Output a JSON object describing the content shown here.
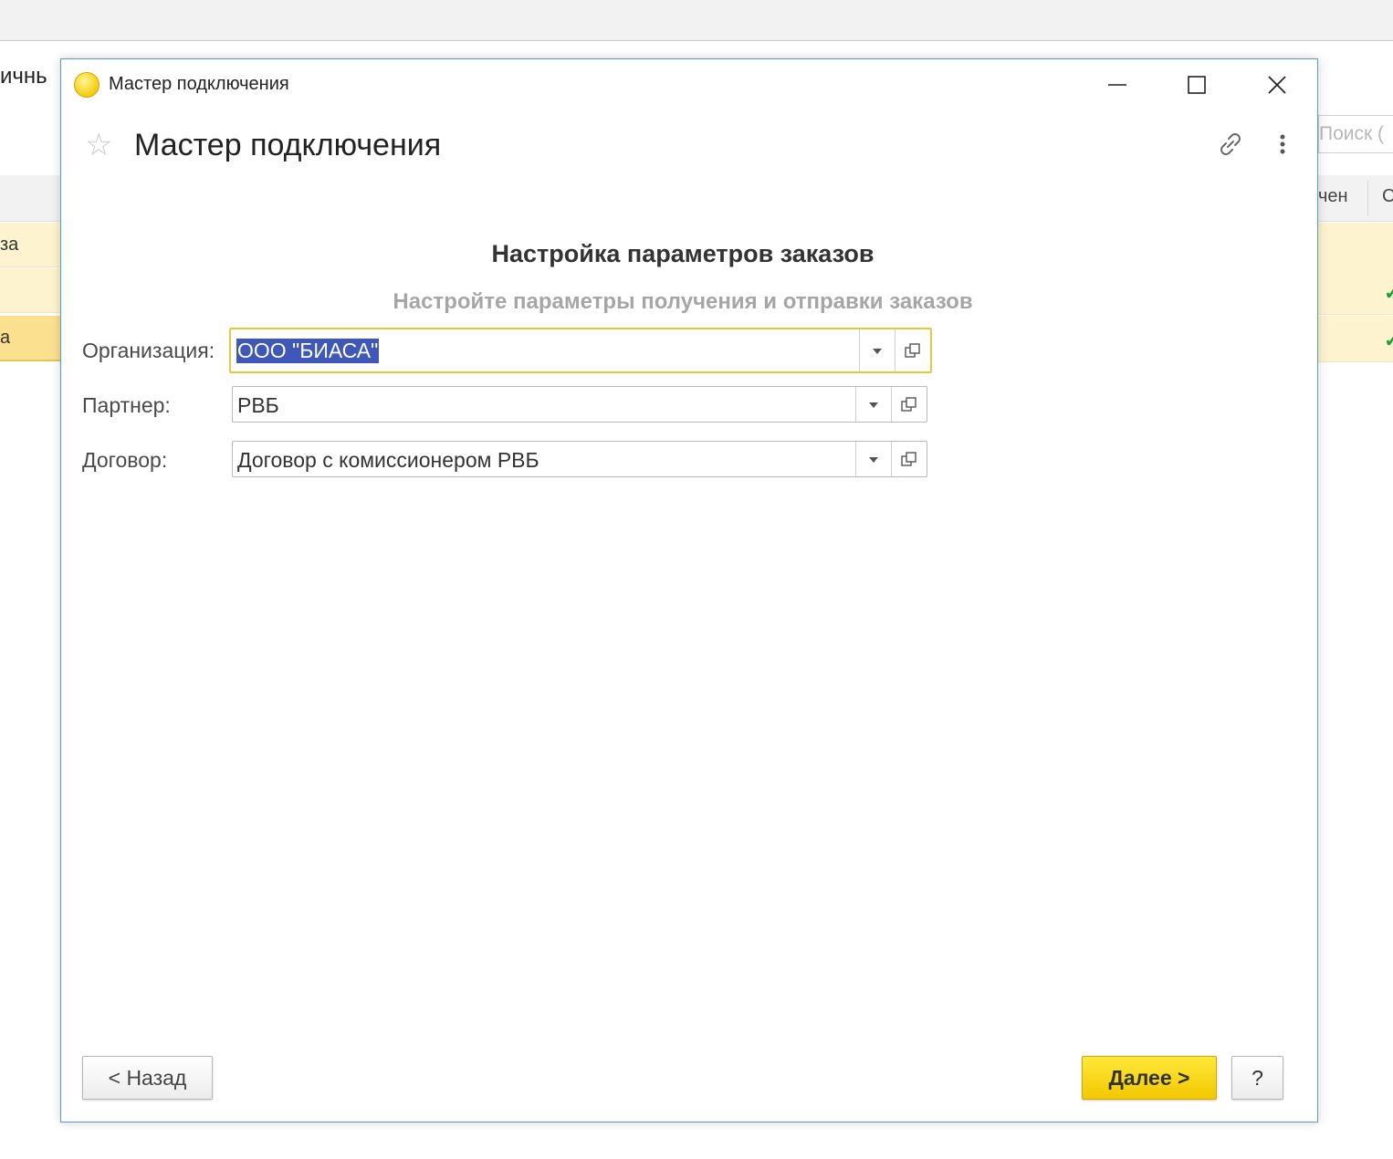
{
  "background": {
    "left_title_fragment": "ичнь",
    "left_rows": [
      "за",
      "",
      "а"
    ],
    "search_placeholder": "Поиск (",
    "right_header": [
      "чен",
      "С"
    ],
    "right_row_ticks": [
      "",
      "✓",
      "✓"
    ]
  },
  "dialog": {
    "window_title": "Мастер подключения",
    "form_title": "Мастер подключения",
    "section_title": "Настройка параметров заказов",
    "section_subtitle": "Настройте параметры получения и отправки заказов",
    "fields": [
      {
        "label": "Организация:",
        "value": "ООО \"БИАСА\""
      },
      {
        "label": "Партнер:",
        "value": "РВБ"
      },
      {
        "label": "Договор:",
        "value": "Договор с комиссионером РВБ"
      }
    ],
    "buttons": {
      "back": "< Назад",
      "next": "Далее >",
      "help": "?"
    }
  },
  "colors": {
    "accent_yellow": "#f2c800",
    "focus_border": "#f3c53a",
    "selection": "#3e57b8",
    "dialog_border": "#5a9bd5"
  },
  "icons": [
    "app-circle-icon",
    "minimize-icon",
    "maximize-icon",
    "close-icon",
    "star-icon",
    "link-icon",
    "more-vertical-icon",
    "dropdown-arrow-icon",
    "open-icon"
  ]
}
